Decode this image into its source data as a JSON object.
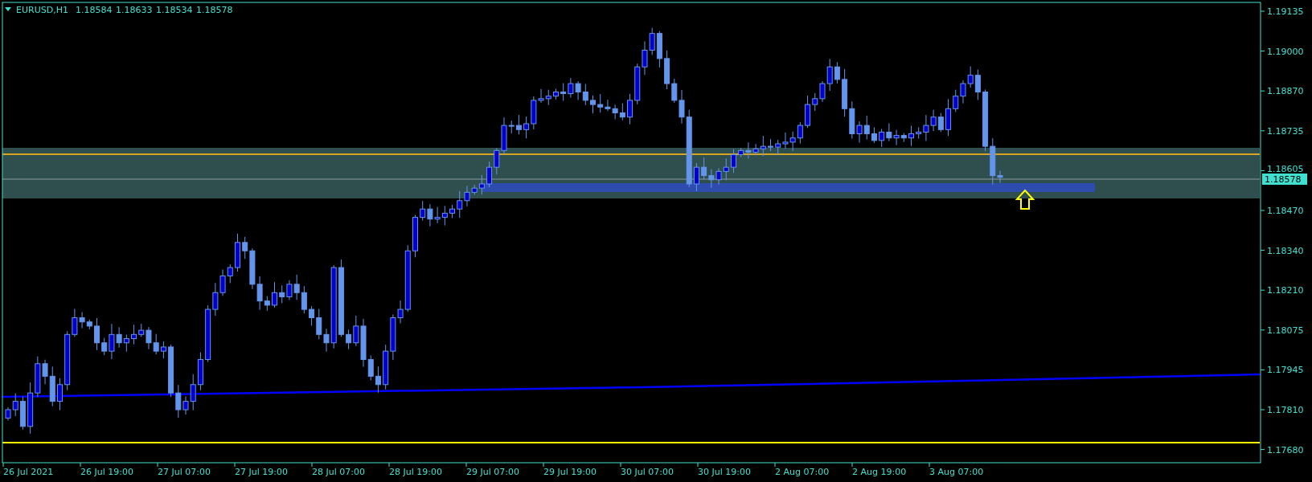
{
  "header": {
    "symbol": "EURUSD,H1",
    "prices": [
      "1.18584",
      "1.18633",
      "1.18534",
      "1.18578"
    ]
  },
  "price_axis": {
    "ticks": [
      "1.19135",
      "1.19000",
      "1.18870",
      "1.18735",
      "1.18605",
      "1.18470",
      "1.18340",
      "1.18210",
      "1.18075",
      "1.17945",
      "1.17810",
      "1.17680"
    ],
    "current_price": "1.18578"
  },
  "time_axis": {
    "ticks": [
      "26 Jul 2021",
      "26 Jul 19:00",
      "27 Jul 07:00",
      "27 Jul 19:00",
      "28 Jul 07:00",
      "28 Jul 19:00",
      "29 Jul 07:00",
      "29 Jul 19:00",
      "30 Jul 07:00",
      "30 Jul 19:00",
      "2 Aug 07:00",
      "2 Aug 19:00",
      "3 Aug 07:00"
    ]
  }
}
